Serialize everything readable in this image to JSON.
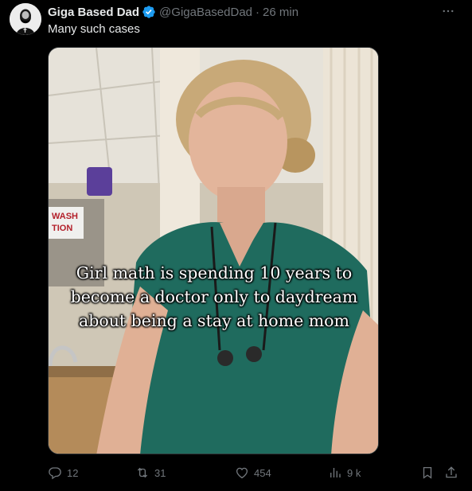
{
  "author": {
    "display_name": "Giga Based Dad",
    "handle": "@GigaBasedDad",
    "separator": "·",
    "time": "26 min"
  },
  "tweet": {
    "text": "Many such cases"
  },
  "media": {
    "caption_lines": [
      "Girl math is spending 10 years to",
      "become a doctor only to daydream",
      "about being a stay at home mom"
    ],
    "sign_text": [
      "WASH",
      "TION"
    ]
  },
  "actions": {
    "reply_count": "12",
    "retweet_count": "31",
    "like_count": "454",
    "views_count": "9 k"
  },
  "icons": {
    "more": "more-icon",
    "verified": "verified-badge-icon",
    "reply": "reply-icon",
    "retweet": "retweet-icon",
    "like": "like-icon",
    "views": "views-icon",
    "bookmark": "bookmark-icon",
    "share": "share-icon"
  },
  "colors": {
    "background": "#000000",
    "text": "#e7e9ea",
    "muted": "#71767b",
    "verified": "#1d9bf0"
  }
}
